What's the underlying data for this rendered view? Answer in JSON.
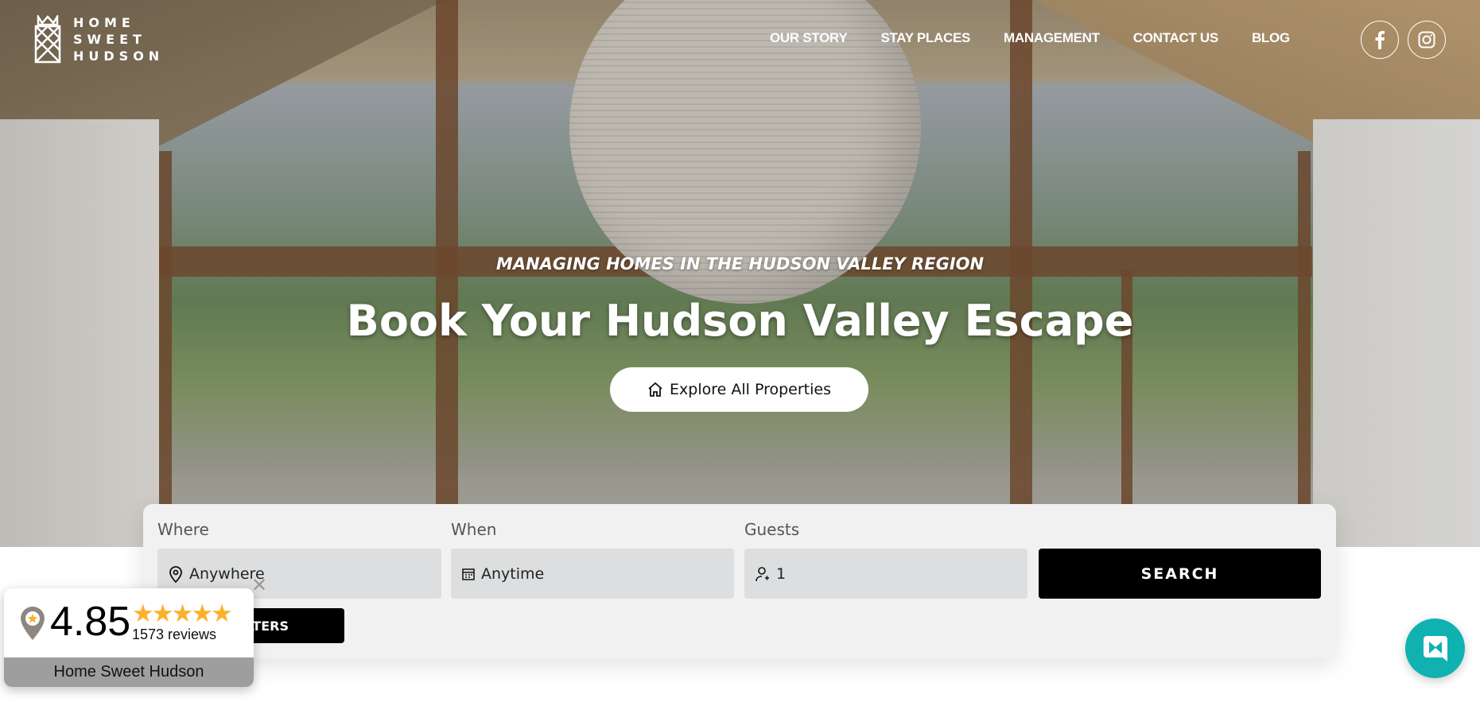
{
  "brand": {
    "name_lines": [
      "HOME",
      "SWEET",
      "HUDSON"
    ]
  },
  "nav": {
    "items": [
      {
        "label": "OUR STORY"
      },
      {
        "label": "STAY PLACES"
      },
      {
        "label": "MANAGEMENT"
      },
      {
        "label": "CONTACT US"
      },
      {
        "label": "BLOG"
      }
    ],
    "social": [
      "facebook-icon",
      "instagram-icon"
    ]
  },
  "hero": {
    "subtitle": "MANAGING HOMES IN THE HUDSON VALLEY REGION",
    "title": "Book Your Hudson Valley Escape",
    "cta": "Explore All Properties"
  },
  "search": {
    "where_label": "Where",
    "where_value": "Anywhere",
    "when_label": "When",
    "when_value": "Anytime",
    "guests_label": "Guests",
    "guests_value": "1",
    "search_label": "SEARCH",
    "filters_label": "FILTERS"
  },
  "review": {
    "score": "4.85",
    "stars": "★★★★★",
    "rating": 4.85,
    "count": "1573 reviews",
    "name": "Home Sweet Hudson",
    "star_color": "#fbb12a"
  },
  "colors": {
    "chat": "#10b1b1",
    "search_button": "#000000",
    "panel": "#f1f1f1"
  }
}
